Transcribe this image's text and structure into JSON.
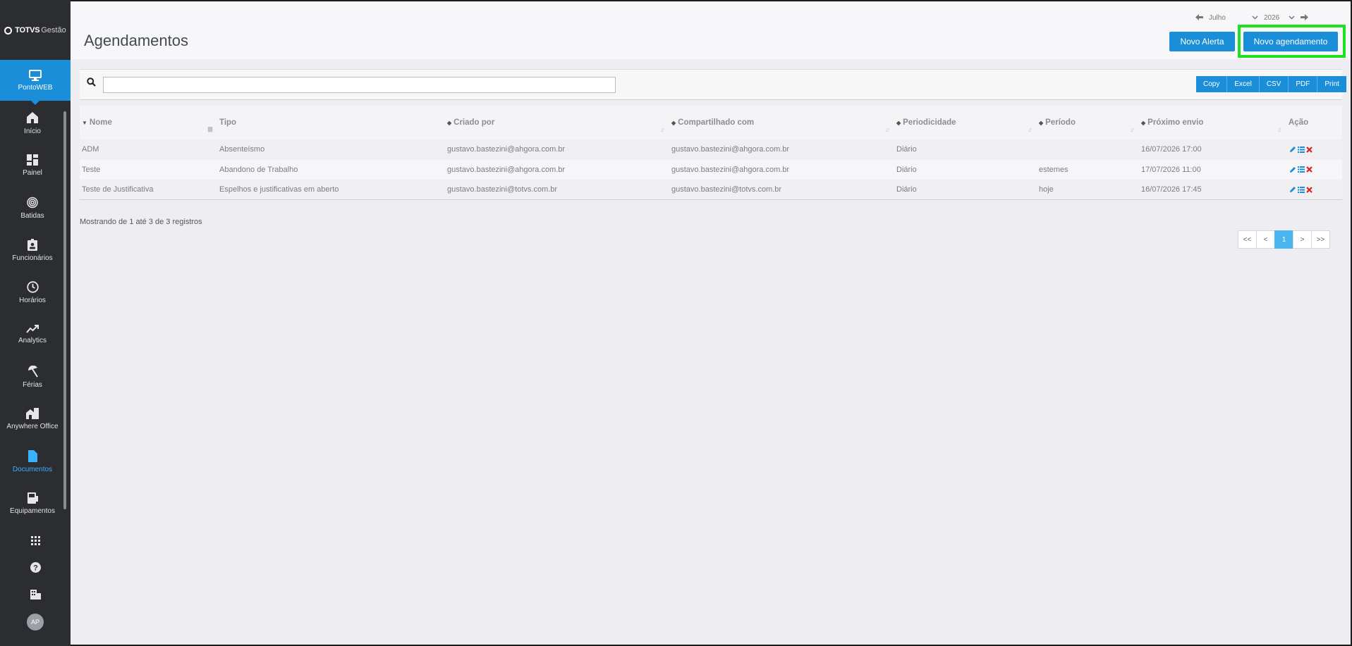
{
  "sidebar": {
    "logo": {
      "brand": "TOTVS",
      "product": "Gestão"
    },
    "module": {
      "label": "PontoWEB",
      "icon": "monitor-icon"
    },
    "items": [
      {
        "label": "Início",
        "icon": "home-icon",
        "active": false
      },
      {
        "label": "Painel",
        "icon": "dashboard-icon",
        "active": false
      },
      {
        "label": "Batidas",
        "icon": "fingerprint-icon",
        "active": false
      },
      {
        "label": "Funcionários",
        "icon": "badge-icon",
        "active": false
      },
      {
        "label": "Horários",
        "icon": "clock-icon",
        "active": false
      },
      {
        "label": "Analytics",
        "icon": "trend-icon",
        "active": false
      },
      {
        "label": "Férias",
        "icon": "beach-icon",
        "active": false
      },
      {
        "label": "Anywhere Office",
        "icon": "office-icon",
        "active": false
      },
      {
        "label": "Documentos",
        "icon": "document-icon",
        "active": true
      },
      {
        "label": "Equipamentos",
        "icon": "device-icon",
        "active": false
      }
    ],
    "bottom": {
      "apps_icon": "apps-grid-icon",
      "help_icon": "help-icon",
      "company_icon": "company-icon",
      "avatar": "AP"
    },
    "active_color": "#3ab0ff"
  },
  "header": {
    "title": "Agendamentos",
    "period": {
      "month": "Julho",
      "year": "2026"
    },
    "buttons": {
      "alert": "Novo Alerta",
      "new": "Novo agendamento"
    }
  },
  "toolbar": {
    "search_placeholder": "",
    "export_buttons": [
      "Copy",
      "Excel",
      "CSV",
      "PDF",
      "Print"
    ]
  },
  "table": {
    "columns": [
      "Nome",
      "Tipo",
      "Criado por",
      "Compartilhado com",
      "Periodicidade",
      "Período",
      "Próximo envio",
      "Ação"
    ],
    "rows": [
      [
        "ADM",
        "Absenteísmo",
        "gustavo.bastezini@ahgora.com.br",
        "gustavo.bastezini@ahgora.com.br",
        "Diário",
        "",
        "16/07/2026 17:00"
      ],
      [
        "Teste",
        "Abandono de Trabalho",
        "gustavo.bastezini@ahgora.com.br",
        "gustavo.bastezini@ahgora.com.br",
        "Diário",
        "estemes",
        "17/07/2026 11:00"
      ],
      [
        "Teste de Justificativa",
        "Espelhos e justificativas em aberto",
        "gustavo.bastezini@totvs.com.br",
        "gustavo.bastezini@totvs.com.br",
        "Diário",
        "hoje",
        "16/07/2026 17:45"
      ]
    ]
  },
  "footer": {
    "info": "Mostrando de 1 até 3 de 3 registros",
    "pager": [
      "<<",
      "<",
      "1",
      ">",
      ">>"
    ],
    "current_page": "1"
  },
  "colors": {
    "primary": "#1a8ed8",
    "highlight": "#1ee01e",
    "sidebar": "#2b2d31"
  }
}
